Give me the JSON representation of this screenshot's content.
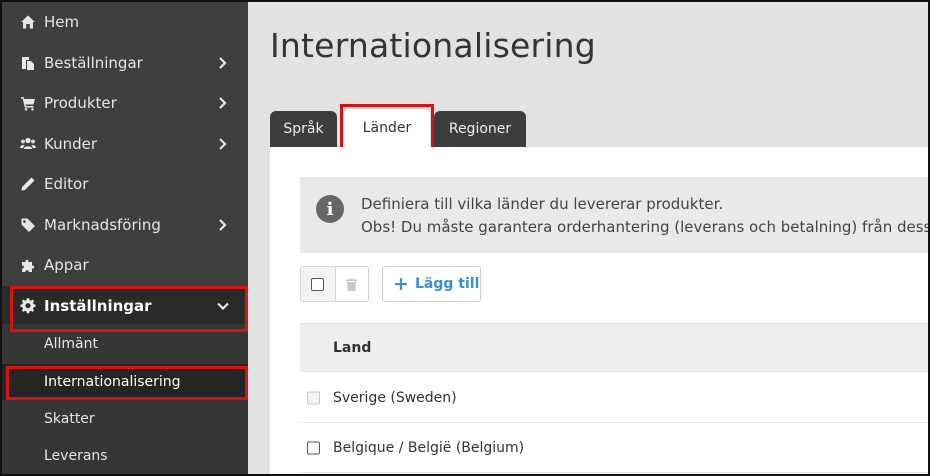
{
  "sidebar": {
    "items": [
      {
        "label": "Hem",
        "icon": "home-icon",
        "has_chevron": false
      },
      {
        "label": "Beställningar",
        "icon": "orders-icon",
        "has_chevron": true
      },
      {
        "label": "Produkter",
        "icon": "cart-icon",
        "has_chevron": true
      },
      {
        "label": "Kunder",
        "icon": "users-icon",
        "has_chevron": true
      },
      {
        "label": "Editor",
        "icon": "pencil-icon",
        "has_chevron": false
      },
      {
        "label": "Marknadsföring",
        "icon": "tag-icon",
        "has_chevron": true
      },
      {
        "label": "Appar",
        "icon": "puzzle-icon",
        "has_chevron": false
      },
      {
        "label": "Inställningar",
        "icon": "gear-icon",
        "has_chevron": true,
        "expanded": true
      }
    ],
    "subitems": [
      {
        "label": "Allmänt"
      },
      {
        "label": "Internationalisering",
        "current": true
      },
      {
        "label": "Skatter"
      },
      {
        "label": "Leverans"
      }
    ]
  },
  "main": {
    "title": "Internationalisering",
    "tabs": [
      {
        "label": "Språk"
      },
      {
        "label": "Länder",
        "selected": true
      },
      {
        "label": "Regioner"
      }
    ],
    "notice": {
      "line1": "Definiera till vilka länder du levererar produkter.",
      "line2": "Obs! Du måste garantera orderhantering (leverans och betalning) från dessa"
    },
    "toolbar": {
      "add_label": "Lägg till"
    },
    "table": {
      "header": "Land",
      "rows": [
        {
          "name": "Sverige (Sweden)",
          "checkbox_disabled": true
        },
        {
          "name": "Belgique / België (Belgium)",
          "checkbox_disabled": false
        }
      ]
    }
  },
  "colors": {
    "sidebar_bg": "#3f3f3f",
    "highlight": "#d41414",
    "accent": "#3a8ed4"
  }
}
